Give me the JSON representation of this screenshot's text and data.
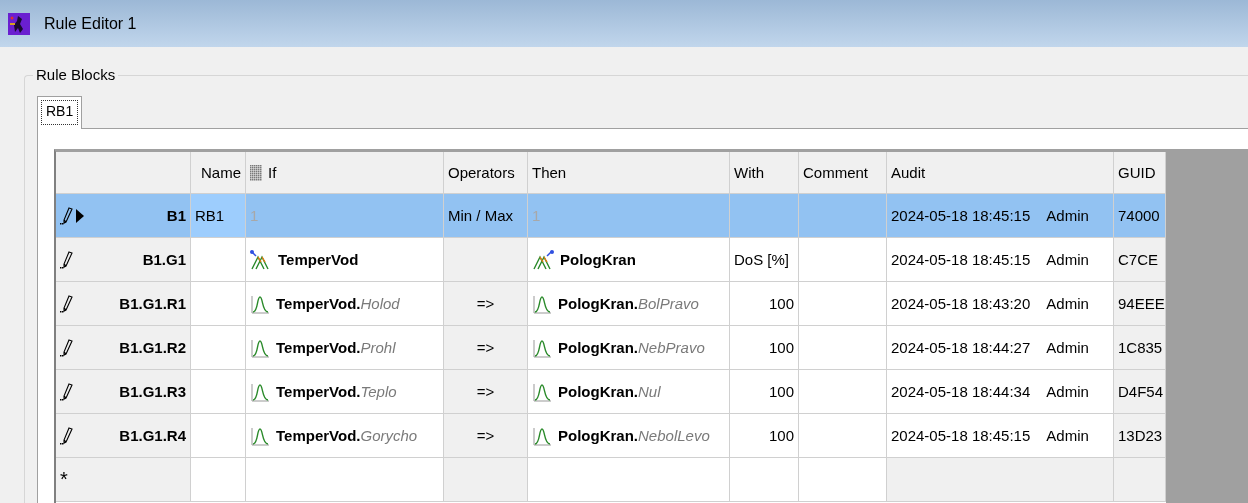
{
  "window": {
    "title": "Rule Editor 1"
  },
  "group_box": {
    "label": "Rule Blocks"
  },
  "tabs": [
    {
      "label": "RB1",
      "selected": true
    }
  ],
  "table": {
    "columns": [
      "Name",
      "If",
      "Operators",
      "Then",
      "With",
      "Comment",
      "Audit",
      "GUID"
    ],
    "rows": [
      {
        "kind": "block",
        "selected": true,
        "id": "B1",
        "name": "RB1",
        "if": "1",
        "operator": "Min / Max",
        "then": "1",
        "audit_time": "2024-05-18 18:45:15",
        "audit_user": "Admin",
        "guid": "74000"
      },
      {
        "kind": "group",
        "selected": false,
        "id": "B1.G1",
        "if": "TemperVod",
        "then": "PologKran",
        "with": "DoS [%]",
        "audit_time": "2024-05-18 18:45:15",
        "audit_user": "Admin",
        "guid": "C7CE"
      },
      {
        "kind": "rule",
        "selected": false,
        "id": "B1.G1.R1",
        "if": "TemperVod.*Holod*",
        "operator": "=>",
        "then": "PologKran.*BolPravo*",
        "with": "100",
        "audit_time": "2024-05-18 18:43:20",
        "audit_user": "Admin",
        "guid": "94EEE"
      },
      {
        "kind": "rule",
        "selected": false,
        "id": "B1.G1.R2",
        "if": "TemperVod.*Prohl*",
        "operator": "=>",
        "then": "PologKran.*NebPravo*",
        "with": "100",
        "audit_time": "2024-05-18 18:44:27",
        "audit_user": "Admin",
        "guid": "1C835"
      },
      {
        "kind": "rule",
        "selected": false,
        "id": "B1.G1.R3",
        "if": "TemperVod.*Teplo*",
        "operator": "=>",
        "then": "PologKran.*Nul*",
        "with": "100",
        "audit_time": "2024-05-18 18:44:34",
        "audit_user": "Admin",
        "guid": "D4F54"
      },
      {
        "kind": "rule",
        "selected": false,
        "id": "B1.G1.R4",
        "if": "TemperVod.*Gorycho*",
        "operator": "=>",
        "then": "PologKran.*NebolLevo*",
        "with": "100",
        "audit_time": "2024-05-18 18:45:15",
        "audit_user": "Admin",
        "guid": "13D23"
      },
      {
        "kind": "new",
        "selected": false,
        "marker": "*"
      }
    ]
  }
}
